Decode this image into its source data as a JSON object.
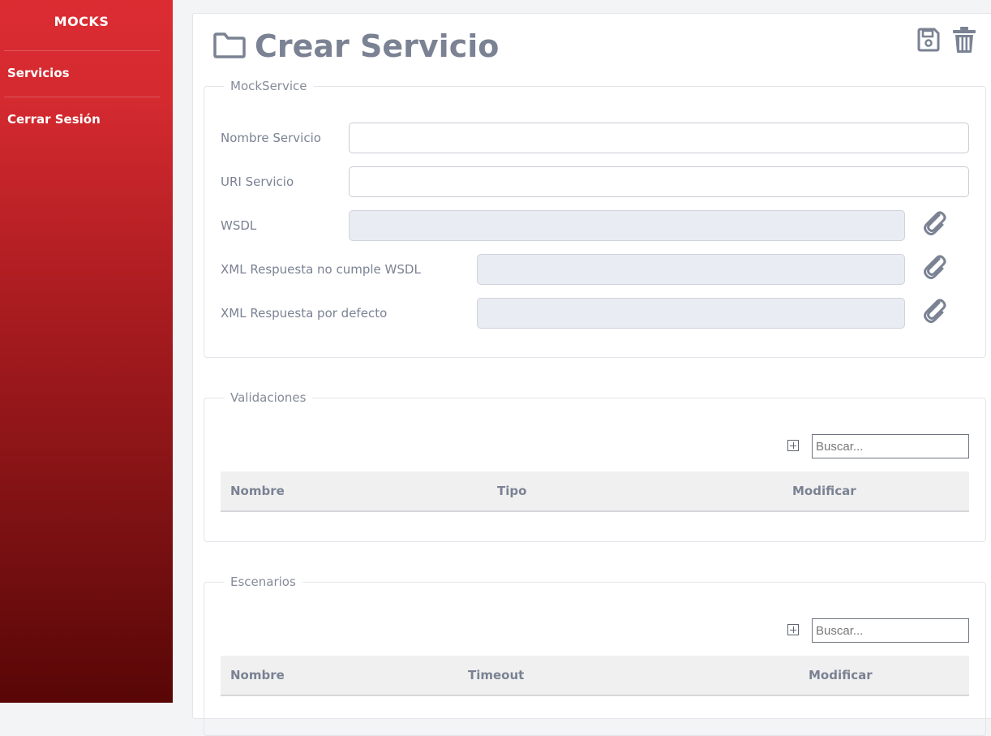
{
  "sidebar": {
    "brand": "MOCKS",
    "items": [
      {
        "label": "Servicios"
      },
      {
        "label": "Cerrar Sesión"
      }
    ]
  },
  "header": {
    "title": "Crear Servicio",
    "icons": [
      "folder-icon",
      "save-icon",
      "trash-icon"
    ]
  },
  "mockservice": {
    "legend": "MockService",
    "fields": [
      {
        "label": "Nombre Servicio",
        "value": ""
      },
      {
        "label": "URI Servicio",
        "value": ""
      },
      {
        "label": "WSDL",
        "value": ""
      },
      {
        "label": "XML Respuesta no cumple WSDL",
        "value": ""
      },
      {
        "label": "XML Respuesta por defecto",
        "value": ""
      }
    ]
  },
  "validaciones": {
    "legend": "Validaciones",
    "search_placeholder": "Buscar...",
    "columns": [
      "Nombre",
      "Tipo",
      "Modificar"
    ]
  },
  "escenarios": {
    "legend": "Escenarios",
    "search_placeholder": "Buscar...",
    "columns": [
      "Nombre",
      "Timeout",
      "Modificar"
    ]
  },
  "colors": {
    "sidebar_top": "#db2c32",
    "sidebar_bottom": "#580606",
    "text_muted": "#7a8293"
  }
}
